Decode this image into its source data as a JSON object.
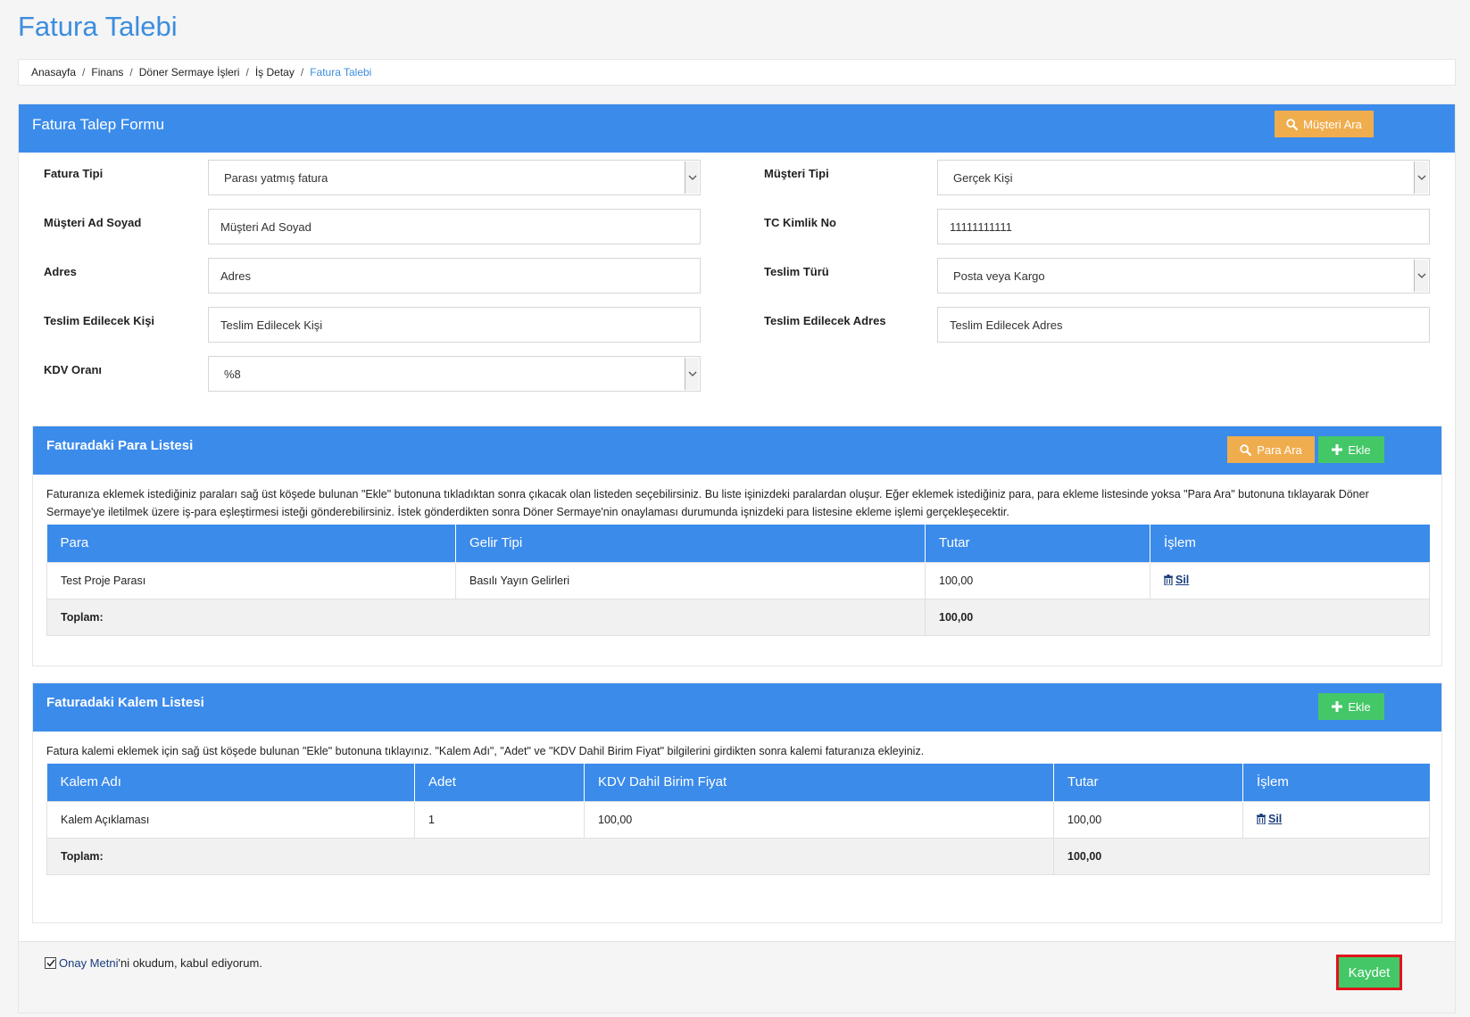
{
  "page": {
    "title": "Fatura Talebi"
  },
  "breadcrumb": [
    "Anasayfa",
    "Finans",
    "Döner Sermaye İşleri",
    "İş Detay",
    "Fatura Talebi"
  ],
  "form": {
    "title": "Fatura Talep Formu",
    "search_customer_label": "Müşteri Ara",
    "fields": {
      "fatura_tipi": {
        "label": "Fatura Tipi",
        "value": "Parası yatmış fatura"
      },
      "musteri_ad": {
        "label": "Müşteri Ad Soyad",
        "value": "Müşteri Ad Soyad"
      },
      "adres": {
        "label": "Adres",
        "value": "Adres"
      },
      "teslim_kisi": {
        "label": "Teslim Edilecek Kişi",
        "value": "Teslim Edilecek Kişi"
      },
      "kdv": {
        "label": "KDV Oranı",
        "value": "%8"
      },
      "musteri_tipi": {
        "label": "Müşteri Tipi",
        "value": "Gerçek Kişi"
      },
      "tc": {
        "label": "TC Kimlik No",
        "value": "11111111111"
      },
      "teslim_turu": {
        "label": "Teslim Türü",
        "value": "Posta veya Kargo"
      },
      "teslim_adres": {
        "label": "Teslim Edilecek Adres",
        "value": "Teslim Edilecek Adres"
      }
    }
  },
  "money_list": {
    "title": "Faturadaki Para Listesi",
    "search_label": "Para Ara",
    "add_label": "Ekle",
    "description": "Faturanıza eklemek istediğiniz paraları sağ üst köşede bulunan \"Ekle\" butonuna tıkladıktan sonra çıkacak olan listeden seçebilirsiniz. Bu liste işinizdeki paralardan oluşur. Eğer eklemek istediğiniz para, para ekleme listesinde yoksa \"Para Ara\" butonuna tıklayarak Döner Sermaye'ye iletilmek üzere iş-para eşleştirmesi isteği gönderebilirsiniz. İstek gönderdikten sonra Döner Sermaye'nin onaylaması durumunda işnizdeki para listesine ekleme işlemi gerçekleşecektir.",
    "headers": [
      "Para",
      "Gelir Tipi",
      "Tutar",
      "İşlem"
    ],
    "rows": [
      {
        "para": "Test Proje Parası",
        "gelir": "Basılı Yayın Gelirleri",
        "tutar": "100,00",
        "action": "Sil"
      }
    ],
    "total_label": "Toplam:",
    "total_value": "100,00"
  },
  "item_list": {
    "title": "Faturadaki Kalem Listesi",
    "add_label": "Ekle",
    "description": "Fatura kalemi eklemek için sağ üst köşede bulunan \"Ekle\" butonuna tıklayınız. \"Kalem Adı\", \"Adet\" ve \"KDV Dahil Birim Fiyat\" bilgilerini girdikten sonra kalemi faturanıza ekleyiniz.",
    "headers": [
      "Kalem Adı",
      "Adet",
      "KDV Dahil Birim Fiyat",
      "Tutar",
      "İşlem"
    ],
    "rows": [
      {
        "kalem": "Kalem Açıklaması",
        "adet": "1",
        "fiyat": "100,00",
        "tutar": "100,00",
        "action": "Sil"
      }
    ],
    "total_label": "Toplam:",
    "total_value": "100,00"
  },
  "footer": {
    "consent_link": "Onay Metni",
    "consent_text": "'ni okudum, kabul ediyorum.",
    "consent_checked": true,
    "save_label": "Kaydet"
  },
  "colors": {
    "primary": "#3b8beb",
    "orange": "#f0ad4e",
    "green": "#44c767",
    "highlight": "#e0141d"
  },
  "icons": {
    "search": "search-icon",
    "plus": "plus-icon",
    "trash": "trash-icon",
    "caret": "chevron-down-icon"
  }
}
